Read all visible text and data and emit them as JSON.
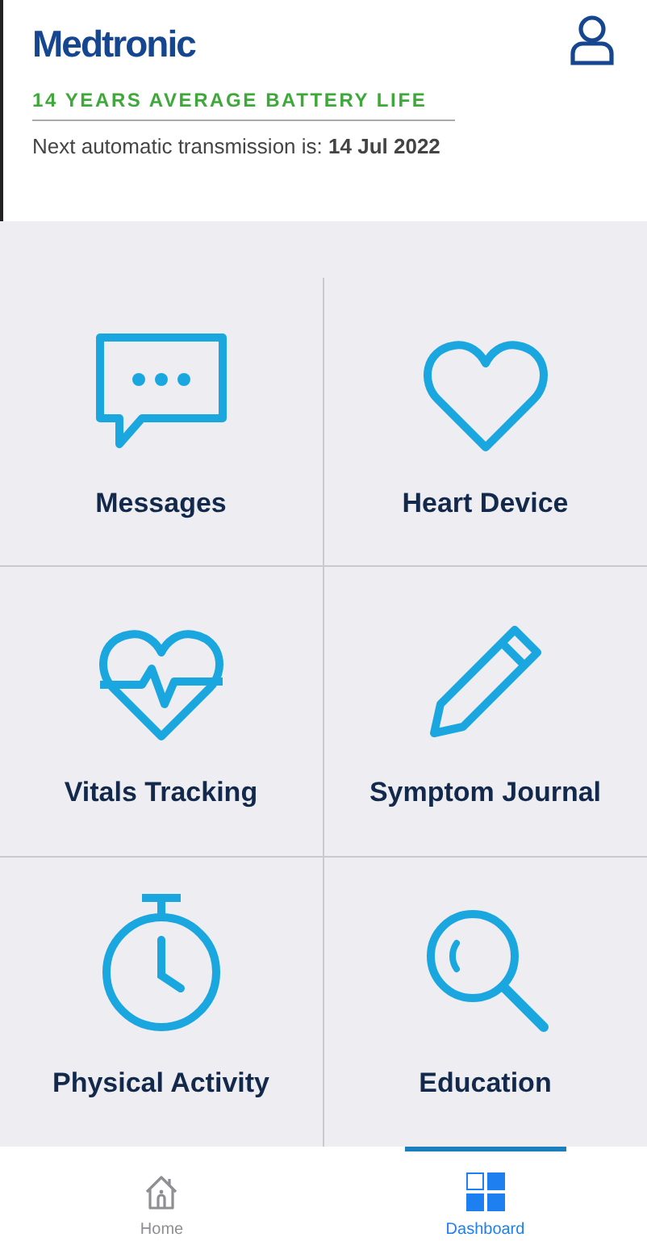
{
  "header": {
    "logo": "Medtronic",
    "battery": "14 YEARS AVERAGE BATTERY LIFE",
    "transmission": "Next automatic transmission is: **14 Jul 2022**"
  },
  "tiles": [
    {
      "kind": "messages",
      "label": "Messages"
    },
    {
      "kind": "heart",
      "label": "Heart Device"
    },
    {
      "kind": "vitals",
      "label": "Vitals Tracking"
    },
    {
      "kind": "journal",
      "label": "Symptom Journal"
    },
    {
      "kind": "activity",
      "label": "Physical Activity"
    },
    {
      "kind": "education",
      "label": "Education"
    }
  ],
  "tabs": [
    {
      "kind": "home",
      "label": "Home",
      "selected": false
    },
    {
      "kind": "dashboard",
      "label": "Dashboard",
      "selected": true
    }
  ]
}
